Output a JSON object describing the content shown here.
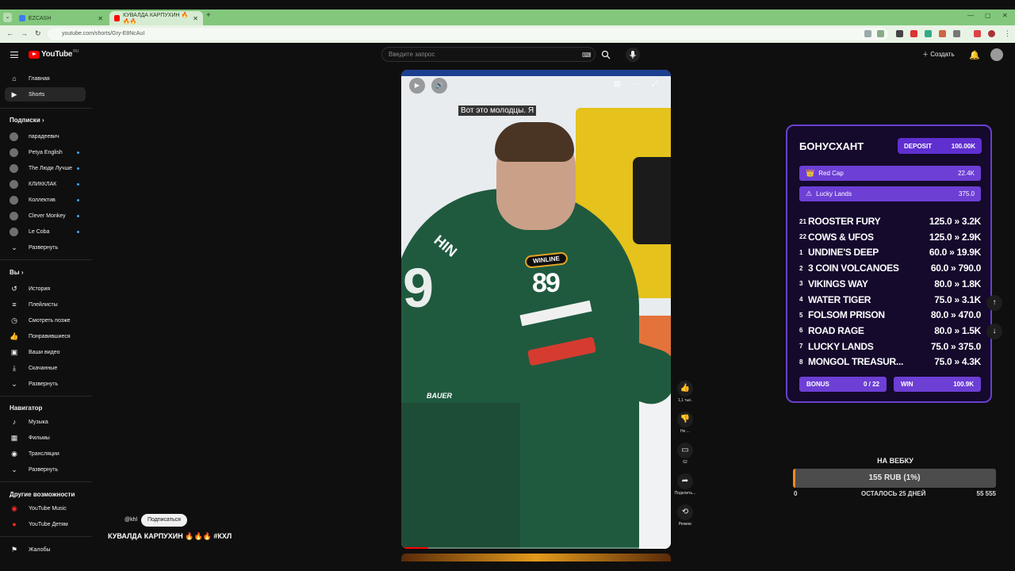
{
  "browser": {
    "tabs": [
      {
        "title": "EZCASH",
        "color": "#3b7cf5"
      },
      {
        "title": "КУВАЛДА КАРПУХИН 🔥🔥🔥",
        "color": "#ff0000"
      }
    ],
    "url": "youtube.com/shorts/Gry-E8NcAuI"
  },
  "header": {
    "logo": "YouTube",
    "logo_cc": "RU",
    "search_placeholder": "Введите запрос",
    "create_label": "Создать"
  },
  "sidebar": {
    "main": [
      {
        "label": "Главная",
        "icon": "home-icon"
      },
      {
        "label": "Shorts",
        "icon": "shorts-icon"
      }
    ],
    "subs_heading": "Подписки",
    "subs": [
      {
        "label": "парадеевич",
        "live": false
      },
      {
        "label": "Petya English",
        "live": true
      },
      {
        "label": "The Люди Лучше",
        "live": true
      },
      {
        "label": "КЛИККЛАК",
        "live": true
      },
      {
        "label": "Коллектив",
        "live": true
      },
      {
        "label": "Clever Monkey",
        "live": true
      },
      {
        "label": "Le Coba",
        "live": true
      }
    ],
    "subs_expand": "Развернуть",
    "you_heading": "Вы",
    "you": [
      {
        "label": "История",
        "icon": "history-icon"
      },
      {
        "label": "Плейлисты",
        "icon": "playlists-icon"
      },
      {
        "label": "Смотреть позже",
        "icon": "watch-later-icon"
      },
      {
        "label": "Понравившиеся",
        "icon": "like-icon"
      },
      {
        "label": "Ваши видео",
        "icon": "your-videos-icon"
      },
      {
        "label": "Скачанные",
        "icon": "download-icon"
      }
    ],
    "you_expand": "Развернуть",
    "nav_heading": "Навигатор",
    "nav": [
      {
        "label": "Музыка",
        "icon": "music-icon"
      },
      {
        "label": "Фильмы",
        "icon": "film-icon"
      },
      {
        "label": "Трансляции",
        "icon": "live-icon"
      }
    ],
    "nav_expand": "Развернуть",
    "more_heading": "Другие возможности",
    "more": [
      {
        "label": "YouTube Music",
        "icon": "youtube-music-icon"
      },
      {
        "label": "YouTube Детям",
        "icon": "youtube-kids-icon"
      }
    ],
    "report": "Жалобы"
  },
  "video": {
    "subtitle": "Вот это молодцы. Я",
    "channel": "@khl",
    "subscribe": "Подписаться",
    "title": "КУВАЛДА КАРПУХИН 🔥🔥🔥 #КХЛ",
    "progress": 0.1,
    "jersey_number": "89",
    "jersey_name": "HIN",
    "sponsor": "WINLINE",
    "brand": "BAUER"
  },
  "actions": [
    {
      "label": "1,1 тыс.",
      "icon": "like-icon"
    },
    {
      "label": "Не ...",
      "icon": "dislike-icon"
    },
    {
      "label": "62",
      "icon": "comment-icon"
    },
    {
      "label": "Поделить...",
      "icon": "share-icon"
    },
    {
      "label": "Ремикс",
      "icon": "remix-icon"
    }
  ],
  "bonushunt": {
    "title": "БОНУСХАНТ",
    "deposit_label": "DEPOSIT",
    "deposit_value": "100.00K",
    "highlights": [
      {
        "name": "Red Cap",
        "value": "22.4K",
        "icon": "crown-icon"
      },
      {
        "name": "Lucky Lands",
        "value": "375.0",
        "icon": "warning-icon"
      }
    ],
    "rows": [
      {
        "idx": "21",
        "name": "ROOSTER FURY",
        "value": "125.0 » 3.2K"
      },
      {
        "idx": "22",
        "name": "COWS & UFOS",
        "value": "125.0 » 2.9K"
      },
      {
        "idx": "1",
        "name": "UNDINE'S DEEP",
        "value": "60.0 » 19.9K"
      },
      {
        "idx": "2",
        "name": "3 COIN VOLCANOES",
        "value": "60.0 » 790.0"
      },
      {
        "idx": "3",
        "name": "VIKINGS WAY",
        "value": "80.0 » 1.8K"
      },
      {
        "idx": "4",
        "name": "WATER TIGER",
        "value": "75.0 » 3.1K"
      },
      {
        "idx": "5",
        "name": "FOLSOM PRISON",
        "value": "80.0 » 470.0"
      },
      {
        "idx": "6",
        "name": "ROAD RAGE",
        "value": "80.0 » 1.5K"
      },
      {
        "idx": "7",
        "name": "LUCKY LANDS",
        "value": "75.0 » 375.0"
      },
      {
        "idx": "8",
        "name": "MONGOL TREASUR...",
        "value": "75.0 » 4.3K"
      }
    ],
    "bonus_label": "BONUS",
    "bonus_value": "0 / 22",
    "win_label": "WIN",
    "win_value": "100.9K",
    "accent": "#6d3fd5"
  },
  "goal": {
    "title": "НА ВЕБКУ",
    "bar_text": "155 RUB (1%)",
    "progress": 0.01,
    "min": "0",
    "remaining": "ОСТАЛОСЬ 25 ДНЕЙ",
    "max": "55 555"
  }
}
